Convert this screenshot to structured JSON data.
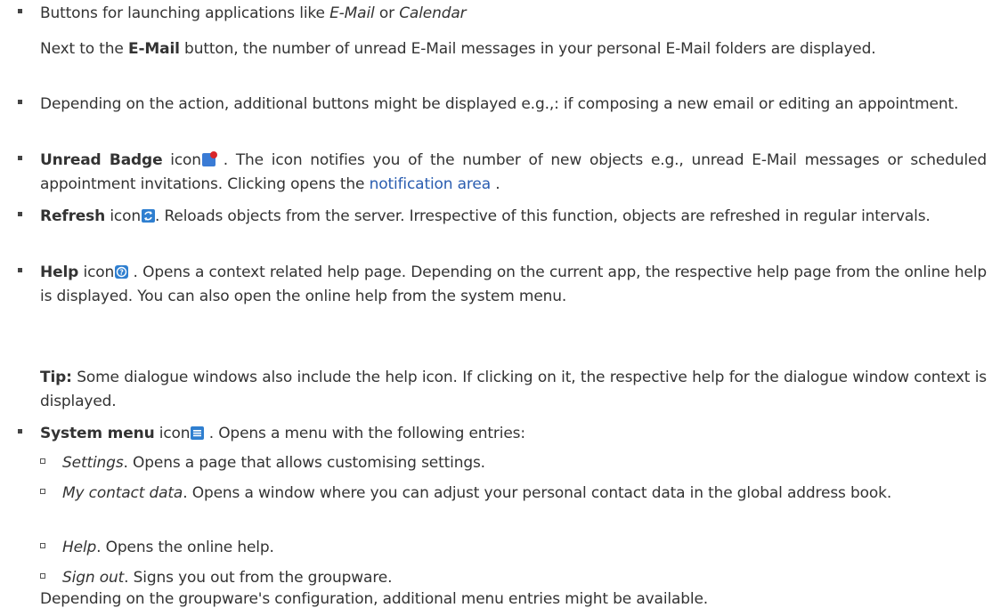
{
  "b1": {
    "t1": "Buttons for launching applications like ",
    "i1": "E-Mail",
    "t2": " or ",
    "i2": "Calendar"
  },
  "p1": {
    "t1": "Next to the ",
    "b1": "E-Mail",
    "t2": " button, the number of unread E-Mail messages in your personal E-Mail folders are displayed."
  },
  "b2": {
    "t1": "Depending on the action, additional buttons might be displayed e.g.,: if composing a new email or editing an appointment."
  },
  "b3": {
    "b1": "Unread Badge",
    "t1": " icon",
    "t2": " . The icon notifies you of the number of new objects e.g., unread E-Mail messages or scheduled appointment invitations. Clicking opens the ",
    "link": "notification area",
    "t3": " ."
  },
  "b4": {
    "b1": "Refresh",
    "t1": " icon",
    "t2": ". Reloads objects from the server. Irrespective of this function, objects are refreshed in regular intervals."
  },
  "b5": {
    "b1": "Help",
    "t1": " icon",
    "t2": " . Opens a context related help page. Depending on the current app, the respective help page from the online help is displayed. You can also open the online help from the system menu."
  },
  "p2": {
    "b1": "Tip:",
    "t1": " Some dialogue windows also include the help icon. If clicking on it, the respective help for the dialogue window context is displayed."
  },
  "b6": {
    "b1": "System menu",
    "t1": " icon",
    "t2": " . Opens a menu with the following entries:"
  },
  "sub": [
    {
      "i": "Settings",
      "t": ". Opens a page that allows customising settings."
    },
    {
      "i": "My contact data",
      "t": ". Opens a window where you can adjust your personal contact data in the global address book."
    },
    {
      "i": "Help",
      "t": ". Opens the online help."
    },
    {
      "i": "Sign out",
      "t": ". Signs you out from the groupware."
    }
  ],
  "p3": {
    "t1": "Depending on the groupware's configuration, additional menu entries might be available."
  },
  "icons": {
    "badge": "unread-badge-icon",
    "refresh": "refresh-icon",
    "help": "help-icon",
    "menu": "system-menu-icon"
  },
  "colors": {
    "text": "#333333",
    "link": "#2a5db0",
    "icon_blue": "#2f7fd0",
    "badge_red": "#d9262a"
  }
}
